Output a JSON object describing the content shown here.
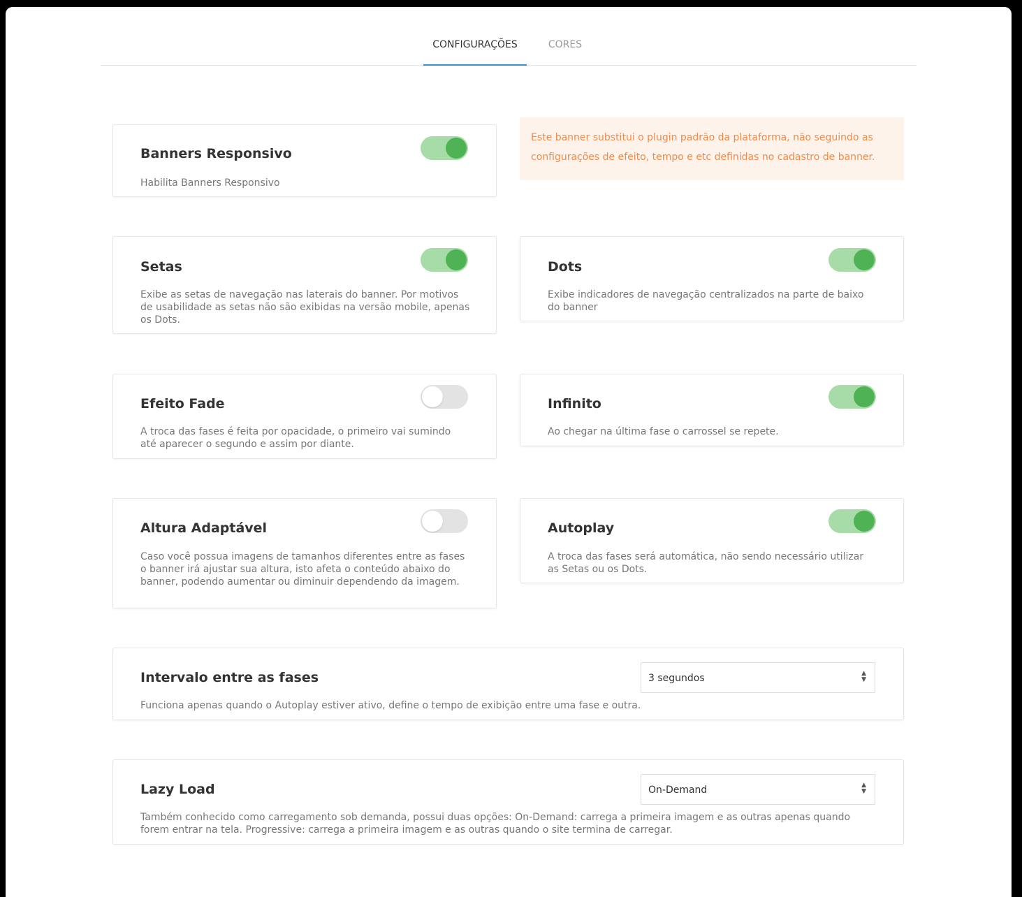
{
  "tabs": [
    {
      "label": "CONFIGURAÇÕES",
      "active": true
    },
    {
      "label": "CORES",
      "active": false
    }
  ],
  "notice": "Este banner substitui o plugin padrão da plataforma, não seguindo as configurações de efeito, tempo e etc definidas no cadastro de banner.",
  "settings": {
    "banners": {
      "title": "Banners Responsivo",
      "desc": "Habilita Banners Responsivo",
      "enabled": true
    },
    "setas": {
      "title": "Setas",
      "desc": "Exibe as setas de navegação nas laterais do banner. Por motivos de usabilidade as setas não são exibidas na versão mobile, apenas os Dots.",
      "enabled": true
    },
    "dots": {
      "title": "Dots",
      "desc": "Exibe indicadores de navegação centralizados na parte de baixo do banner",
      "enabled": true
    },
    "fade": {
      "title": "Efeito Fade",
      "desc": "A troca das fases é feita por opacidade, o primeiro vai sumindo até aparecer o segundo e assim por diante.",
      "enabled": false
    },
    "infinito": {
      "title": "Infinito",
      "desc": "Ao chegar na última fase o carrossel se repete.",
      "enabled": true
    },
    "altura": {
      "title": "Altura Adaptável",
      "desc": "Caso você possua imagens de tamanhos diferentes entre as fases o banner irá ajustar sua altura, isto afeta o conteúdo abaixo do banner, podendo aumentar ou diminuir dependendo da imagem.",
      "enabled": false
    },
    "autoplay": {
      "title": "Autoplay",
      "desc": "A troca das fases será automática, não sendo necessário utilizar as Setas ou os Dots.",
      "enabled": true
    },
    "intervalo": {
      "title": "Intervalo entre as fases",
      "desc": "Funciona apenas quando o Autoplay estiver ativo, define o tempo de exibição entre uma fase e outra.",
      "value": "3 segundos"
    },
    "lazy": {
      "title": "Lazy Load",
      "desc": "Também conhecido como carregamento sob demanda, possui duas opções: On-Demand: carrega a primeira imagem e as outras apenas quando forem entrar na tela. Progressive: carrega a primeira imagem e as outras quando o site termina de carregar.",
      "value": "On-Demand"
    }
  }
}
